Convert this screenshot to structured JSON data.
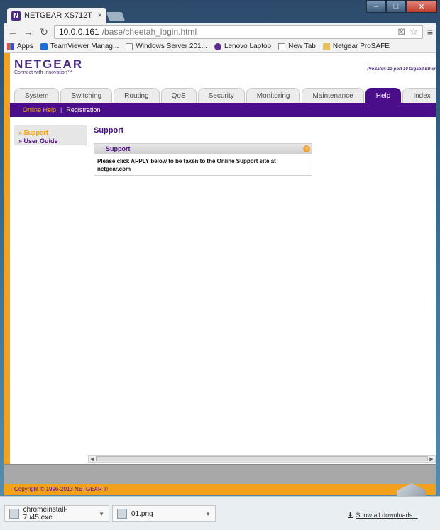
{
  "browser": {
    "tab_title": "NETGEAR XS712T",
    "tab_favicon_letter": "N",
    "close_glyph": "×",
    "url_host": "10.0.0.161",
    "url_path": "/base/cheetah_login.html",
    "window_minimize": "–",
    "window_maximize": "□",
    "window_close": "✕"
  },
  "bookmarks": [
    {
      "label": "Apps",
      "icon": "apps-icon"
    },
    {
      "label": "TeamViewer Manag...",
      "icon": "teamviewer-icon"
    },
    {
      "label": "Windows Server 201...",
      "icon": "page-icon"
    },
    {
      "label": "Lenovo Laptop",
      "icon": "peace-icon"
    },
    {
      "label": "New Tab",
      "icon": "page-icon"
    },
    {
      "label": "Netgear ProSAFE",
      "icon": "folder-icon"
    }
  ],
  "header": {
    "logo": "NETGEAR",
    "tagline": "Connect with Innovation™",
    "product": "ProSafe® 12-port 10 Gigabit Ether"
  },
  "tabs": [
    "System",
    "Switching",
    "Routing",
    "QoS",
    "Security",
    "Monitoring",
    "Maintenance",
    "Help",
    "Index"
  ],
  "active_tab": "Help",
  "subnav": {
    "selected": "Online Help",
    "separator": "|",
    "other": "Registration"
  },
  "sidebar": [
    {
      "label": "» Support",
      "selected": true
    },
    {
      "label": "» User Guide",
      "selected": false
    }
  ],
  "content": {
    "title": "Support",
    "panel_title": "Support",
    "help_glyph": "?",
    "body": "Please click APPLY below to be taken to the Online Support site at netgear.com"
  },
  "footer": {
    "copyright": "Copyright © 1996-2013 NETGEAR ®"
  },
  "downloads": {
    "items": [
      {
        "label": "chromeinstall-7u45.exe"
      },
      {
        "label": "01.png"
      }
    ],
    "show_all": "Show all downloads..."
  },
  "colors": {
    "brand_purple": "#4b0e8a",
    "accent_orange": "#f3a11a"
  }
}
